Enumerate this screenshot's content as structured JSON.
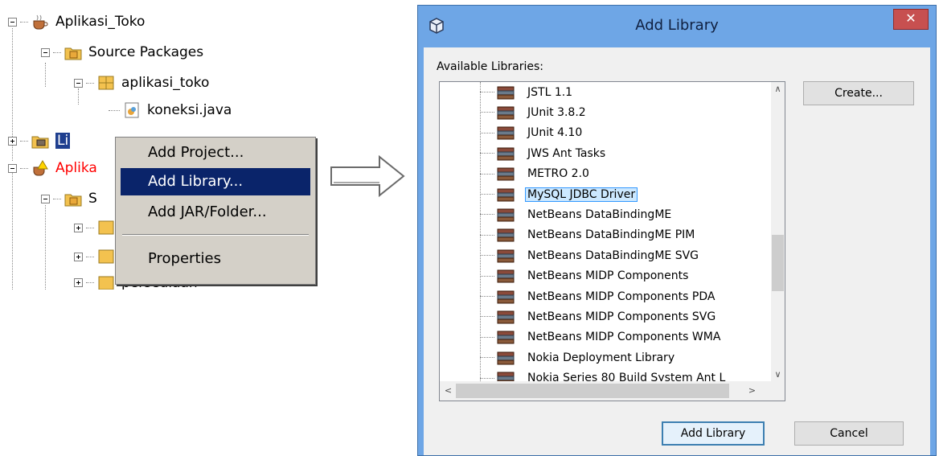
{
  "project_tree": {
    "project1": "Aplikasi_Toko",
    "source_packages": "Source Packages",
    "package": "aplikasi_toko",
    "file": "koneksi.java",
    "libraries_partial": "Li",
    "project2_partial": "Aplika",
    "source_packages2_partial": "S",
    "persediaan_partial": "persediaan"
  },
  "context_menu": {
    "items": [
      {
        "label": "Add Project..."
      },
      {
        "label": "Add Library..."
      },
      {
        "label": "Add JAR/Folder..."
      },
      {
        "label": "Properties"
      }
    ],
    "highlighted_index": 1
  },
  "dialog": {
    "title": "Add Library",
    "close_label": "✕",
    "available_label": "Available Libraries:",
    "libraries": [
      "JSTL 1.1",
      "JUnit 3.8.2",
      "JUnit 4.10",
      "JWS Ant Tasks",
      "METRO 2.0",
      "MySQL JDBC Driver",
      "NetBeans DataBindingME",
      "NetBeans DataBindingME PIM",
      "NetBeans DataBindingME SVG",
      "NetBeans MIDP Components",
      "NetBeans MIDP Components PDA",
      "NetBeans MIDP Components SVG",
      "NetBeans MIDP Components WMA",
      "Nokia Deployment Library",
      "Nokia Series 80 Build System Ant L"
    ],
    "selected_library": "MySQL JDBC Driver",
    "create_button": "Create...",
    "add_button": "Add Library",
    "cancel_button": "Cancel"
  },
  "colors": {
    "selection_bg": "#cce8ff",
    "menu_highlight": "#0a246a",
    "dialog_frame": "#6ea6e6",
    "close_button": "#c75050"
  }
}
